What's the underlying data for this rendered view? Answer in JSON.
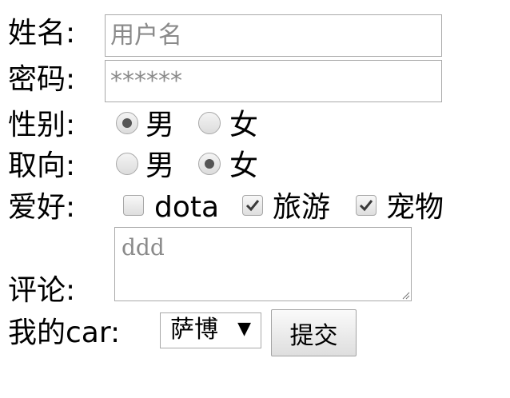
{
  "form": {
    "name": {
      "label": "姓名:",
      "placeholder": "用户名",
      "value": ""
    },
    "password": {
      "label": "密码:",
      "placeholder": "******",
      "value": ""
    },
    "gender": {
      "label": "性别:",
      "options": [
        "男",
        "女"
      ],
      "selected": "男"
    },
    "orientation": {
      "label": "取向:",
      "options": [
        "男",
        "女"
      ],
      "selected": "女"
    },
    "hobbies": {
      "label": "爱好:",
      "options": [
        {
          "label": "dota",
          "checked": false
        },
        {
          "label": "旅游",
          "checked": true
        },
        {
          "label": "宠物",
          "checked": true
        }
      ]
    },
    "comment": {
      "label": "评论:",
      "placeholder": "ddd"
    },
    "car": {
      "label": "我的car:",
      "selected": "萨博",
      "arrow": "▼"
    },
    "submit": {
      "label": "提交"
    }
  }
}
